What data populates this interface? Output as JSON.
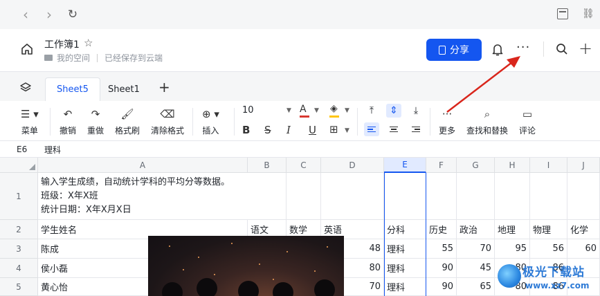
{
  "browser": {
    "back": "‹",
    "forward": "›",
    "reload": "↻"
  },
  "header": {
    "doc_title": "工作簿1",
    "location": "我的空间",
    "save_status": "已经保存到云端",
    "share_label": "分享",
    "more_label": "···"
  },
  "tabs": [
    {
      "label": "Sheet5",
      "active": true
    },
    {
      "label": "Sheet1",
      "active": false
    }
  ],
  "toolbar": {
    "menu": "菜单",
    "undo": "撤销",
    "redo": "重做",
    "format_painter": "格式刷",
    "clear_format": "清除格式",
    "insert": "插入",
    "font_size": "10",
    "bold": "B",
    "strike": "S",
    "italic": "I",
    "underline": "U",
    "font_color": "A",
    "more": "更多",
    "find_replace": "查找和替换",
    "comment": "评论",
    "accent": "#1456f0"
  },
  "formula": {
    "cell_ref": "E6",
    "value": "理科"
  },
  "grid": {
    "columns": [
      "A",
      "B",
      "C",
      "D",
      "E",
      "F",
      "G",
      "H",
      "I",
      "J"
    ],
    "selected_column": "E",
    "row_numbers": [
      "1",
      "2",
      "3",
      "4",
      "5"
    ],
    "row1_lines": [
      "输入学生成绩，自动统计学科的平均分等数据。",
      "班级：X年X班",
      "统计日期：X年X月X日"
    ],
    "row2": [
      "学生姓名",
      "语文",
      "数学",
      "英语",
      "",
      "分科",
      "历史",
      "政治",
      "地理",
      "物理",
      "化学"
    ],
    "rows": [
      {
        "name": "陈成",
        "d": "48",
        "e": "理科",
        "f": "55",
        "g": "70",
        "h": "95",
        "i": "56",
        "j": "60"
      },
      {
        "name": "侯小磊",
        "d": "80",
        "e": "理科",
        "f": "90",
        "g": "45",
        "h": "80",
        "i": "86",
        "j": ""
      },
      {
        "name": "黄心怡",
        "d": "70",
        "e": "理科",
        "f": "90",
        "g": "65",
        "h": "80",
        "i": "86",
        "j": ""
      }
    ]
  },
  "watermark": {
    "text": "极光下载站",
    "url": "www.xz7.com"
  }
}
